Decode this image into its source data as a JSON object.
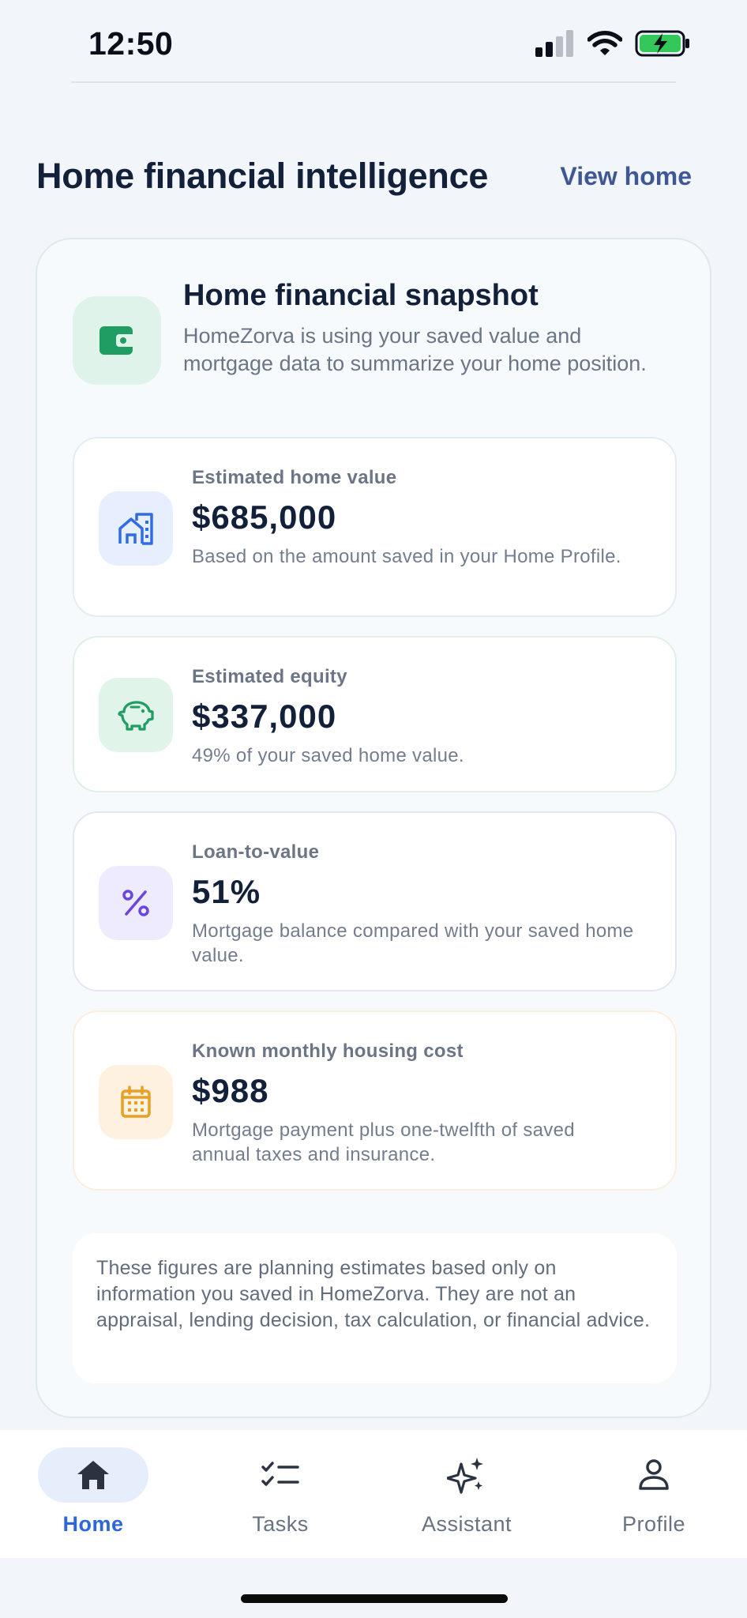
{
  "status_bar": {
    "time": "12:50"
  },
  "header": {
    "title": "Home financial intelligence",
    "view_home_label": "View home"
  },
  "snapshot": {
    "title": "Home financial snapshot",
    "description": "HomeZorva is using your saved value and mortgage data to summarize your home position.",
    "icon": "wallet-icon",
    "metrics": [
      {
        "label": "Estimated home value",
        "value": "$685,000",
        "note": "Based on the amount saved in your Home Profile.",
        "icon": "home-city-icon",
        "accent": "#2f6de0"
      },
      {
        "label": "Estimated equity",
        "value": "$337,000",
        "note": "49% of your saved home value.",
        "icon": "piggy-bank-icon",
        "accent": "#1f9d62"
      },
      {
        "label": "Loan-to-value",
        "value": "51%",
        "note": "Mortgage balance compared with your saved home value.",
        "icon": "percent-icon",
        "accent": "#6a45e0"
      },
      {
        "label": "Known monthly housing cost",
        "value": "$988",
        "note": "Mortgage payment plus one-twelfth of saved annual taxes and insurance.",
        "icon": "calendar-icon",
        "accent": "#e8a022"
      }
    ],
    "disclaimer": "These figures are planning estimates based only on information you saved in HomeZorva. They are not an appraisal, lending decision, tax calculation, or financial advice."
  },
  "nav": {
    "items": [
      {
        "label": "Home",
        "icon": "home-icon",
        "active": true
      },
      {
        "label": "Tasks",
        "icon": "checklist-icon",
        "active": false
      },
      {
        "label": "Assistant",
        "icon": "sparkles-icon",
        "active": false
      },
      {
        "label": "Profile",
        "icon": "person-icon",
        "active": false
      }
    ]
  },
  "colors": {
    "brand_blue": "#2d67d8",
    "text_dark": "#13203a",
    "muted": "#6b7586"
  }
}
